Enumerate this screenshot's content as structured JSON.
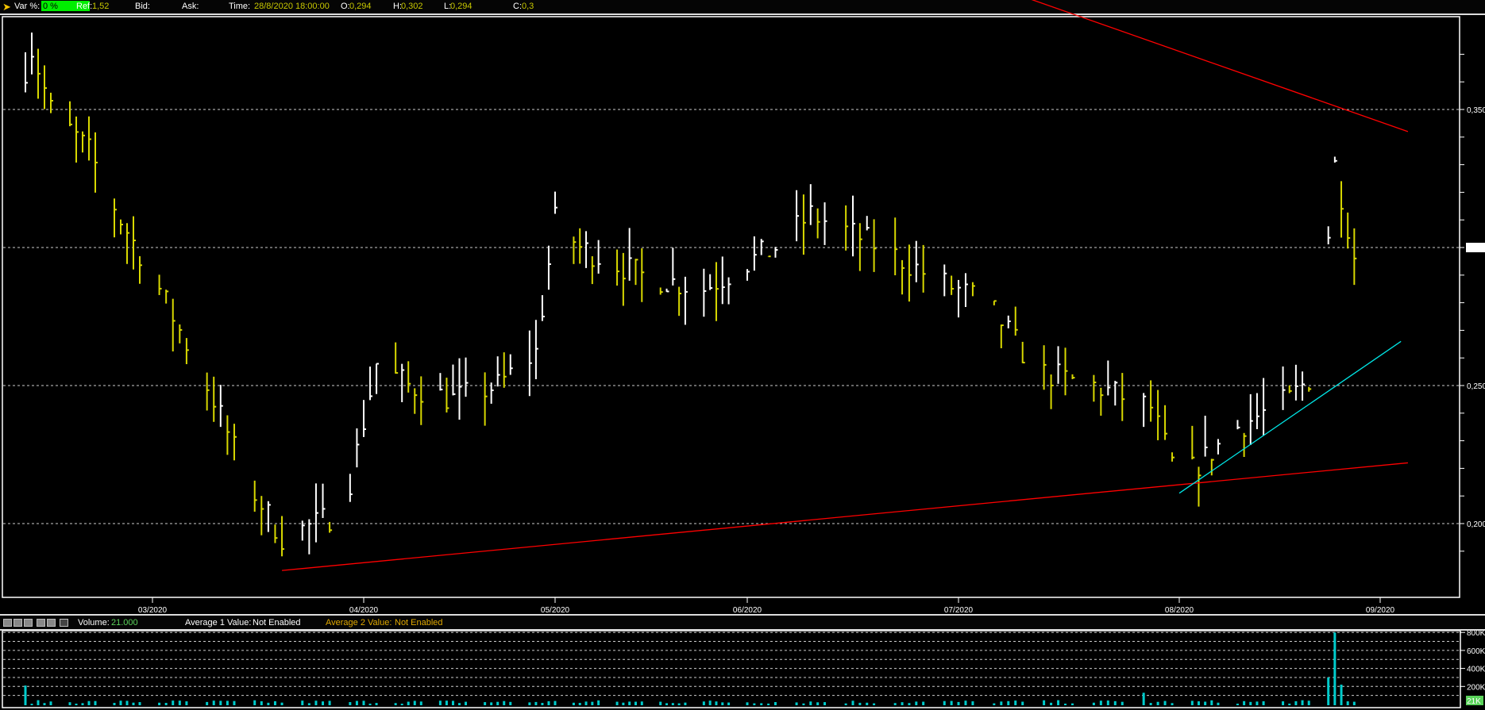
{
  "topbar": {
    "var_label": "Var %:",
    "var_value": "0 %",
    "ref_label": "Ref:",
    "ref_value": "1,52",
    "bid_label": "Bid:",
    "ask_label": "Ask:",
    "time_label": "Time:",
    "time_value": "28/8/2020 18:00:00",
    "open_label": "O:",
    "open_value": "0,294",
    "high_label": "H:",
    "high_value": "0,302",
    "low_label": "L:",
    "low_value": "0,294",
    "close_label": "C:",
    "close_value": "0,3"
  },
  "volume_header": {
    "volume_label": "Volume:",
    "volume_value": "21.000",
    "avg1_label": "Average 1 Value:",
    "avg1_value": "Not Enabled",
    "avg2_label": "Average 2 Value:",
    "avg2_value": "Not Enabled"
  },
  "colors": {
    "bar_up": "#ffffff",
    "bar_down": "#d8d800",
    "trend_red": "#ff0000",
    "trend_cyan": "#00e5e5",
    "volume": "#00cccc",
    "var_box": "#00ee00"
  },
  "chart_data": {
    "type": "bar",
    "title": "",
    "price_axis": {
      "ylim": [
        0.18,
        0.385
      ],
      "labels": [
        "0,350",
        "0,300",
        "0,250",
        "0,200"
      ],
      "label_values": [
        0.35,
        0.3,
        0.25,
        0.2
      ],
      "highlight": "0,300"
    },
    "date_axis": {
      "labels": [
        "03/2020",
        "04/2020",
        "05/2020",
        "06/2020",
        "07/2020",
        "08/2020",
        "09/2020"
      ]
    },
    "price_path": [
      [
        "2020-02-08",
        0.35
      ],
      [
        "2020-02-11",
        0.372
      ],
      [
        "2020-02-14",
        0.35
      ],
      [
        "2020-02-20",
        0.335
      ],
      [
        "2020-02-25",
        0.31
      ],
      [
        "2020-03-01",
        0.29
      ],
      [
        "2020-03-05",
        0.27
      ],
      [
        "2020-03-10",
        0.245
      ],
      [
        "2020-03-15",
        0.215
      ],
      [
        "2020-03-20",
        0.195
      ],
      [
        "2020-03-25",
        0.2
      ],
      [
        "2020-03-29",
        0.205
      ],
      [
        "2020-04-03",
        0.258
      ],
      [
        "2020-04-08",
        0.25
      ],
      [
        "2020-04-15",
        0.245
      ],
      [
        "2020-04-22",
        0.25
      ],
      [
        "2020-04-28",
        0.262
      ],
      [
        "2020-05-01",
        0.31
      ],
      [
        "2020-05-05",
        0.3
      ],
      [
        "2020-05-15",
        0.29
      ],
      [
        "2020-05-25",
        0.285
      ],
      [
        "2020-06-05",
        0.3
      ],
      [
        "2020-06-10",
        0.312
      ],
      [
        "2020-06-20",
        0.3
      ],
      [
        "2020-06-28",
        0.288
      ],
      [
        "2020-07-05",
        0.28
      ],
      [
        "2020-07-12",
        0.255
      ],
      [
        "2020-07-20",
        0.25
      ],
      [
        "2020-07-28",
        0.242
      ],
      [
        "2020-08-01",
        0.215
      ],
      [
        "2020-08-10",
        0.235
      ],
      [
        "2020-08-18",
        0.245
      ],
      [
        "2020-08-22",
        0.255
      ],
      [
        "2020-08-25",
        0.33
      ],
      [
        "2020-08-28",
        0.297
      ]
    ],
    "trendlines": [
      {
        "color": "red",
        "from": [
          "2020-06-30",
          0.4
        ],
        "to": [
          "2020-09-05",
          0.342
        ]
      },
      {
        "color": "red",
        "from": [
          "2020-03-20",
          0.183
        ],
        "to": [
          "2020-09-05",
          0.222
        ]
      },
      {
        "color": "cyan",
        "from": [
          "2020-08-01",
          0.211
        ],
        "to": [
          "2020-09-04",
          0.266
        ]
      }
    ],
    "volume": {
      "axis_labels": [
        "800K",
        "600K",
        "400K",
        "200K"
      ],
      "axis_values": [
        800000,
        600000,
        400000,
        200000
      ],
      "last_label": "21K",
      "last_value": 21000,
      "ylim": [
        0,
        820000
      ],
      "spikes": [
        [
          "2020-02-10",
          210000
        ],
        [
          "2020-07-27",
          130000
        ],
        [
          "2020-08-24",
          300000
        ],
        [
          "2020-08-25",
          800000
        ],
        [
          "2020-08-26",
          220000
        ]
      ],
      "baseline": 25000
    }
  }
}
